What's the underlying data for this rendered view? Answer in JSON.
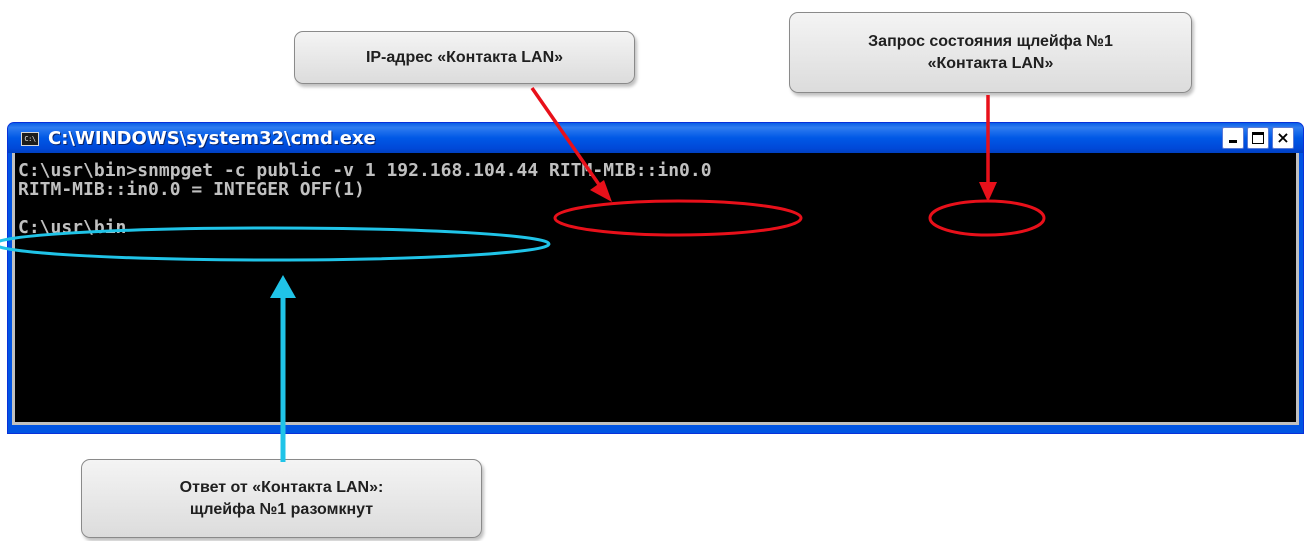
{
  "callouts": {
    "ip_address": {
      "line1": "IP-адрес «Контакта LAN»"
    },
    "query": {
      "line1": "Запрос состояния щлейфа №1",
      "line2": "«Контакта LAN»"
    },
    "response": {
      "line1": "Ответ от  «Контакта LAN»:",
      "line2": "щлейфа №1 разомкнут"
    }
  },
  "window": {
    "title": "C:\\WINDOWS\\system32\\cmd.exe",
    "icon_label": "C:\\",
    "close_glyph": "×"
  },
  "console": {
    "lines": [
      "C:\\usr\\bin>snmpget -c public -v 1 192.168.104.44 RITM-MIB::in0.0",
      "RITM-MIB::in0.0 = INTEGER OFF(1)",
      "",
      "C:\\usr\\bin"
    ]
  },
  "colors": {
    "annotation_red": "#e8101a",
    "annotation_cyan": "#20c4e8",
    "titlebar_blue": "#0058e6",
    "console_bg": "#000000",
    "console_text": "#c0c0c0"
  }
}
